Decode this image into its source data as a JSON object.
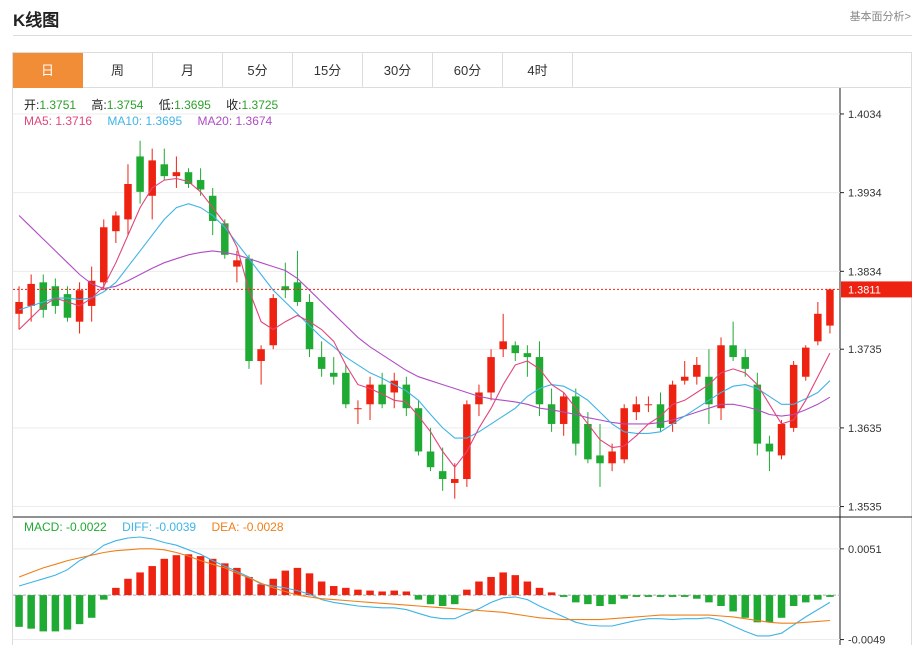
{
  "header": {
    "title": "K线图",
    "link": "基本面分析>"
  },
  "tabs": [
    {
      "label": "日",
      "active": true
    },
    {
      "label": "周",
      "active": false
    },
    {
      "label": "月",
      "active": false
    },
    {
      "label": "5分",
      "active": false
    },
    {
      "label": "15分",
      "active": false
    },
    {
      "label": "30分",
      "active": false
    },
    {
      "label": "60分",
      "active": false
    },
    {
      "label": "4时",
      "active": false
    }
  ],
  "ohlc": {
    "open_label": "开:",
    "open": "1.3751",
    "high_label": "高:",
    "high": "1.3754",
    "low_label": "低:",
    "low": "1.3695",
    "close_label": "收:",
    "close": "1.3725"
  },
  "ma": {
    "ma5_label": "MA5:",
    "ma5": "1.3716",
    "ma10_label": "MA10:",
    "ma10": "1.3695",
    "ma20_label": "MA20:",
    "ma20": "1.3674"
  },
  "macd_legend": {
    "macd_label": "MACD:",
    "macd": "-0.0022",
    "diff_label": "DIFF:",
    "diff": "-0.0039",
    "dea_label": "DEA:",
    "dea": "-0.0028"
  },
  "colors": {
    "up": "#ee2211",
    "down": "#1faa33",
    "ma5": "#e0457b",
    "ma10": "#3fb4e6",
    "ma20": "#b04cc4",
    "dea": "#ef7f1a",
    "accent": "#f08d36"
  },
  "chart_data": [
    {
      "type": "candlestick",
      "ylim": [
        1.3523,
        1.4067
      ],
      "y_ticks": [
        "1.4034",
        "1.3934",
        "1.3834",
        "1.3735",
        "1.3635",
        "1.3535"
      ],
      "current_price": "1.3811",
      "candles": [
        [
          1.378,
          1.3815,
          1.376,
          1.3795
        ],
        [
          1.379,
          1.383,
          1.377,
          1.3818
        ],
        [
          1.382,
          1.383,
          1.3775,
          1.3785
        ],
        [
          1.3815,
          1.3825,
          1.378,
          1.379
        ],
        [
          1.3805,
          1.3815,
          1.377,
          1.3775
        ],
        [
          1.377,
          1.382,
          1.3755,
          1.381
        ],
        [
          1.379,
          1.384,
          1.377,
          1.3822
        ],
        [
          1.382,
          1.39,
          1.381,
          1.389
        ],
        [
          1.3885,
          1.391,
          1.387,
          1.3905
        ],
        [
          1.39,
          1.397,
          1.388,
          1.3945
        ],
        [
          1.398,
          1.4,
          1.392,
          1.3935
        ],
        [
          1.393,
          1.399,
          1.39,
          1.3975
        ],
        [
          1.397,
          1.399,
          1.395,
          1.3955
        ],
        [
          1.3955,
          1.398,
          1.394,
          1.396
        ],
        [
          1.396,
          1.3965,
          1.394,
          1.3945
        ],
        [
          1.395,
          1.3965,
          1.393,
          1.3938
        ],
        [
          1.393,
          1.394,
          1.388,
          1.3898
        ],
        [
          1.3895,
          1.39,
          1.385,
          1.3855
        ],
        [
          1.384,
          1.386,
          1.382,
          1.3848
        ],
        [
          1.385,
          1.3855,
          1.371,
          1.372
        ],
        [
          1.372,
          1.374,
          1.369,
          1.3735
        ],
        [
          1.374,
          1.3805,
          1.3735,
          1.38
        ],
        [
          1.3815,
          1.3845,
          1.38,
          1.381
        ],
        [
          1.382,
          1.386,
          1.379,
          1.3795
        ],
        [
          1.3795,
          1.3805,
          1.3725,
          1.3735
        ],
        [
          1.3725,
          1.3745,
          1.37,
          1.371
        ],
        [
          1.3705,
          1.3725,
          1.369,
          1.37
        ],
        [
          1.3705,
          1.3715,
          1.366,
          1.3665
        ],
        [
          1.366,
          1.367,
          1.364,
          1.366
        ],
        [
          1.3665,
          1.37,
          1.3645,
          1.369
        ],
        [
          1.369,
          1.3705,
          1.366,
          1.3665
        ],
        [
          1.368,
          1.3705,
          1.366,
          1.3695
        ],
        [
          1.369,
          1.37,
          1.365,
          1.366
        ],
        [
          1.366,
          1.367,
          1.36,
          1.3605
        ],
        [
          1.3605,
          1.3635,
          1.358,
          1.3585
        ],
        [
          1.358,
          1.361,
          1.3555,
          1.357
        ],
        [
          1.3565,
          1.359,
          1.3545,
          1.357
        ],
        [
          1.357,
          1.367,
          1.356,
          1.3665
        ],
        [
          1.3665,
          1.369,
          1.365,
          1.368
        ],
        [
          1.368,
          1.3735,
          1.367,
          1.3725
        ],
        [
          1.3735,
          1.378,
          1.3725,
          1.3745
        ],
        [
          1.374,
          1.3745,
          1.372,
          1.373
        ],
        [
          1.373,
          1.374,
          1.37,
          1.3725
        ],
        [
          1.3725,
          1.3745,
          1.365,
          1.3665
        ],
        [
          1.3665,
          1.3685,
          1.363,
          1.364
        ],
        [
          1.364,
          1.368,
          1.3625,
          1.3675
        ],
        [
          1.3675,
          1.3685,
          1.36,
          1.3615
        ],
        [
          1.364,
          1.3655,
          1.359,
          1.3595
        ],
        [
          1.36,
          1.364,
          1.356,
          1.359
        ],
        [
          1.359,
          1.3615,
          1.358,
          1.3605
        ],
        [
          1.3595,
          1.3665,
          1.359,
          1.366
        ],
        [
          1.3655,
          1.3675,
          1.3645,
          1.3665
        ],
        [
          1.3665,
          1.3675,
          1.3655,
          1.3665
        ],
        [
          1.3665,
          1.368,
          1.363,
          1.3635
        ],
        [
          1.364,
          1.3695,
          1.363,
          1.369
        ],
        [
          1.3695,
          1.372,
          1.369,
          1.37
        ],
        [
          1.37,
          1.3725,
          1.369,
          1.3715
        ],
        [
          1.37,
          1.3735,
          1.364,
          1.3665
        ],
        [
          1.366,
          1.375,
          1.3645,
          1.374
        ],
        [
          1.374,
          1.377,
          1.372,
          1.3725
        ],
        [
          1.3725,
          1.3735,
          1.37,
          1.371
        ],
        [
          1.369,
          1.3705,
          1.36,
          1.3615
        ],
        [
          1.3615,
          1.3625,
          1.358,
          1.3605
        ],
        [
          1.36,
          1.3645,
          1.3595,
          1.364
        ],
        [
          1.3635,
          1.372,
          1.363,
          1.3715
        ],
        [
          1.37,
          1.374,
          1.3695,
          1.3737
        ],
        [
          1.3745,
          1.3795,
          1.374,
          1.378
        ],
        [
          1.3765,
          1.3812,
          1.3755,
          1.3811
        ]
      ],
      "ma5": [
        1.376,
        1.3775,
        1.379,
        1.38,
        1.3795,
        1.379,
        1.38,
        1.3815,
        1.3845,
        1.388,
        1.3915,
        1.394,
        1.395,
        1.3952,
        1.3948,
        1.3935,
        1.3915,
        1.3895,
        1.3865,
        1.381,
        1.377,
        1.376,
        1.377,
        1.3778,
        1.377,
        1.376,
        1.3745,
        1.3715,
        1.369,
        1.3685,
        1.3678,
        1.367,
        1.3668,
        1.365,
        1.363,
        1.3605,
        1.3585,
        1.3605,
        1.3635,
        1.366,
        1.369,
        1.3715,
        1.372,
        1.371,
        1.369,
        1.368,
        1.366,
        1.364,
        1.362,
        1.361,
        1.3612,
        1.3625,
        1.364,
        1.365,
        1.3665,
        1.367,
        1.368,
        1.369,
        1.3705,
        1.371,
        1.3705,
        1.369,
        1.3665,
        1.364,
        1.3645,
        1.367,
        1.37,
        1.373
      ],
      "ma10": [
        1.3785,
        1.379,
        1.3795,
        1.38,
        1.38,
        1.3798,
        1.38,
        1.3808,
        1.382,
        1.384,
        1.386,
        1.388,
        1.39,
        1.3915,
        1.392,
        1.3915,
        1.3905,
        1.389,
        1.387,
        1.385,
        1.383,
        1.381,
        1.3795,
        1.378,
        1.3765,
        1.375,
        1.3738,
        1.3725,
        1.3715,
        1.3705,
        1.3698,
        1.369,
        1.3682,
        1.367,
        1.3652,
        1.3635,
        1.3622,
        1.3622,
        1.363,
        1.364,
        1.365,
        1.366,
        1.3675,
        1.3685,
        1.369,
        1.3688,
        1.368,
        1.367,
        1.3655,
        1.364,
        1.363,
        1.3628,
        1.3628,
        1.363,
        1.364,
        1.365,
        1.366,
        1.367,
        1.368,
        1.3688,
        1.369,
        1.3685,
        1.3675,
        1.3665,
        1.3665,
        1.3672,
        1.368,
        1.3695
      ],
      "ma20": [
        1.3905,
        1.389,
        1.3875,
        1.386,
        1.3845,
        1.383,
        1.3818,
        1.3812,
        1.3815,
        1.3822,
        1.383,
        1.3838,
        1.3845,
        1.385,
        1.3855,
        1.3858,
        1.386,
        1.3858,
        1.3855,
        1.385,
        1.3845,
        1.384,
        1.3835,
        1.3825,
        1.381,
        1.3795,
        1.378,
        1.3765,
        1.375,
        1.3738,
        1.3728,
        1.3718,
        1.3708,
        1.37,
        1.3695,
        1.369,
        1.3685,
        1.368,
        1.3675,
        1.3672,
        1.367,
        1.3668,
        1.3665,
        1.366,
        1.3658,
        1.3655,
        1.3652,
        1.3648,
        1.3645,
        1.3642,
        1.364,
        1.364,
        1.364,
        1.3642,
        1.3645,
        1.365,
        1.3655,
        1.366,
        1.3665,
        1.3665,
        1.3662,
        1.3658,
        1.3652,
        1.365,
        1.3652,
        1.3658,
        1.3665,
        1.3674
      ]
    },
    {
      "type": "macd",
      "ylim": [
        -0.0055,
        0.0085
      ],
      "y_ticks": [
        "0.0051",
        "-0.0049"
      ],
      "hist": [
        -0.0035,
        -0.0037,
        -0.004,
        -0.004,
        -0.0038,
        -0.0032,
        -0.0025,
        -0.0005,
        0.0008,
        0.0018,
        0.0025,
        0.0032,
        0.004,
        0.0044,
        0.0045,
        0.0043,
        0.004,
        0.0035,
        0.003,
        0.002,
        0.0012,
        0.0018,
        0.0027,
        0.003,
        0.0024,
        0.0015,
        0.001,
        0.0008,
        0.0006,
        0.0005,
        0.0004,
        0.0005,
        0.0004,
        -0.0005,
        -0.001,
        -0.0012,
        -0.001,
        0.0006,
        0.0015,
        0.002,
        0.0025,
        0.0022,
        0.0015,
        0.0008,
        0.0003,
        -0.0002,
        -0.0008,
        -0.001,
        -0.0012,
        -0.001,
        -0.0004,
        -0.0002,
        -0.0002,
        -0.0002,
        -0.0002,
        -0.0002,
        -0.0004,
        -0.0008,
        -0.0012,
        -0.0018,
        -0.0025,
        -0.003,
        -0.003,
        -0.0025,
        -0.0012,
        -0.0008,
        -0.0005,
        -0.0002
      ],
      "diff": [
        0.001,
        0.0014,
        0.0018,
        0.0022,
        0.0028,
        0.0038,
        0.0045,
        0.0055,
        0.006,
        0.0063,
        0.0064,
        0.0062,
        0.0058,
        0.0055,
        0.005,
        0.0045,
        0.0038,
        0.0032,
        0.0026,
        0.002,
        0.0012,
        0.001,
        0.0008,
        0.0005,
        0.0001,
        -0.0005,
        -0.0008,
        -0.001,
        -0.0012,
        -0.0013,
        -0.0014,
        -0.0014,
        -0.0016,
        -0.002,
        -0.0024,
        -0.0026,
        -0.0026,
        -0.002,
        -0.0015,
        -0.0008,
        -0.0003,
        -0.0002,
        -0.0005,
        -0.0012,
        -0.0018,
        -0.0024,
        -0.003,
        -0.0033,
        -0.0034,
        -0.0034,
        -0.0031,
        -0.0028,
        -0.0026,
        -0.0026,
        -0.0027,
        -0.0026,
        -0.0026,
        -0.0025,
        -0.0028,
        -0.0034,
        -0.004,
        -0.0045,
        -0.0045,
        -0.0042,
        -0.0033,
        -0.0024,
        -0.0016,
        -0.0008
      ],
      "dea": [
        0.002,
        0.0025,
        0.003,
        0.0034,
        0.0038,
        0.0041,
        0.0044,
        0.0047,
        0.0049,
        0.005,
        0.0051,
        0.0051,
        0.005,
        0.0047,
        0.0043,
        0.0038,
        0.0034,
        0.003,
        0.0024,
        0.0019,
        0.0013,
        0.0008,
        0.0004,
        0.0,
        -0.0002,
        -0.0004,
        -0.0005,
        -0.0006,
        -0.0007,
        -0.0008,
        -0.0009,
        -0.001,
        -0.0011,
        -0.0012,
        -0.0013,
        -0.0014,
        -0.0015,
        -0.0016,
        -0.0017,
        -0.0018,
        -0.0019,
        -0.0021,
        -0.0023,
        -0.0025,
        -0.0026,
        -0.0027,
        -0.0027,
        -0.0027,
        -0.0027,
        -0.0026,
        -0.0025,
        -0.0024,
        -0.0023,
        -0.0022,
        -0.0022,
        -0.0022,
        -0.0022,
        -0.0022,
        -0.0023,
        -0.0024,
        -0.0026,
        -0.0028,
        -0.003,
        -0.0031,
        -0.0031,
        -0.003,
        -0.0029,
        -0.0028
      ]
    }
  ]
}
